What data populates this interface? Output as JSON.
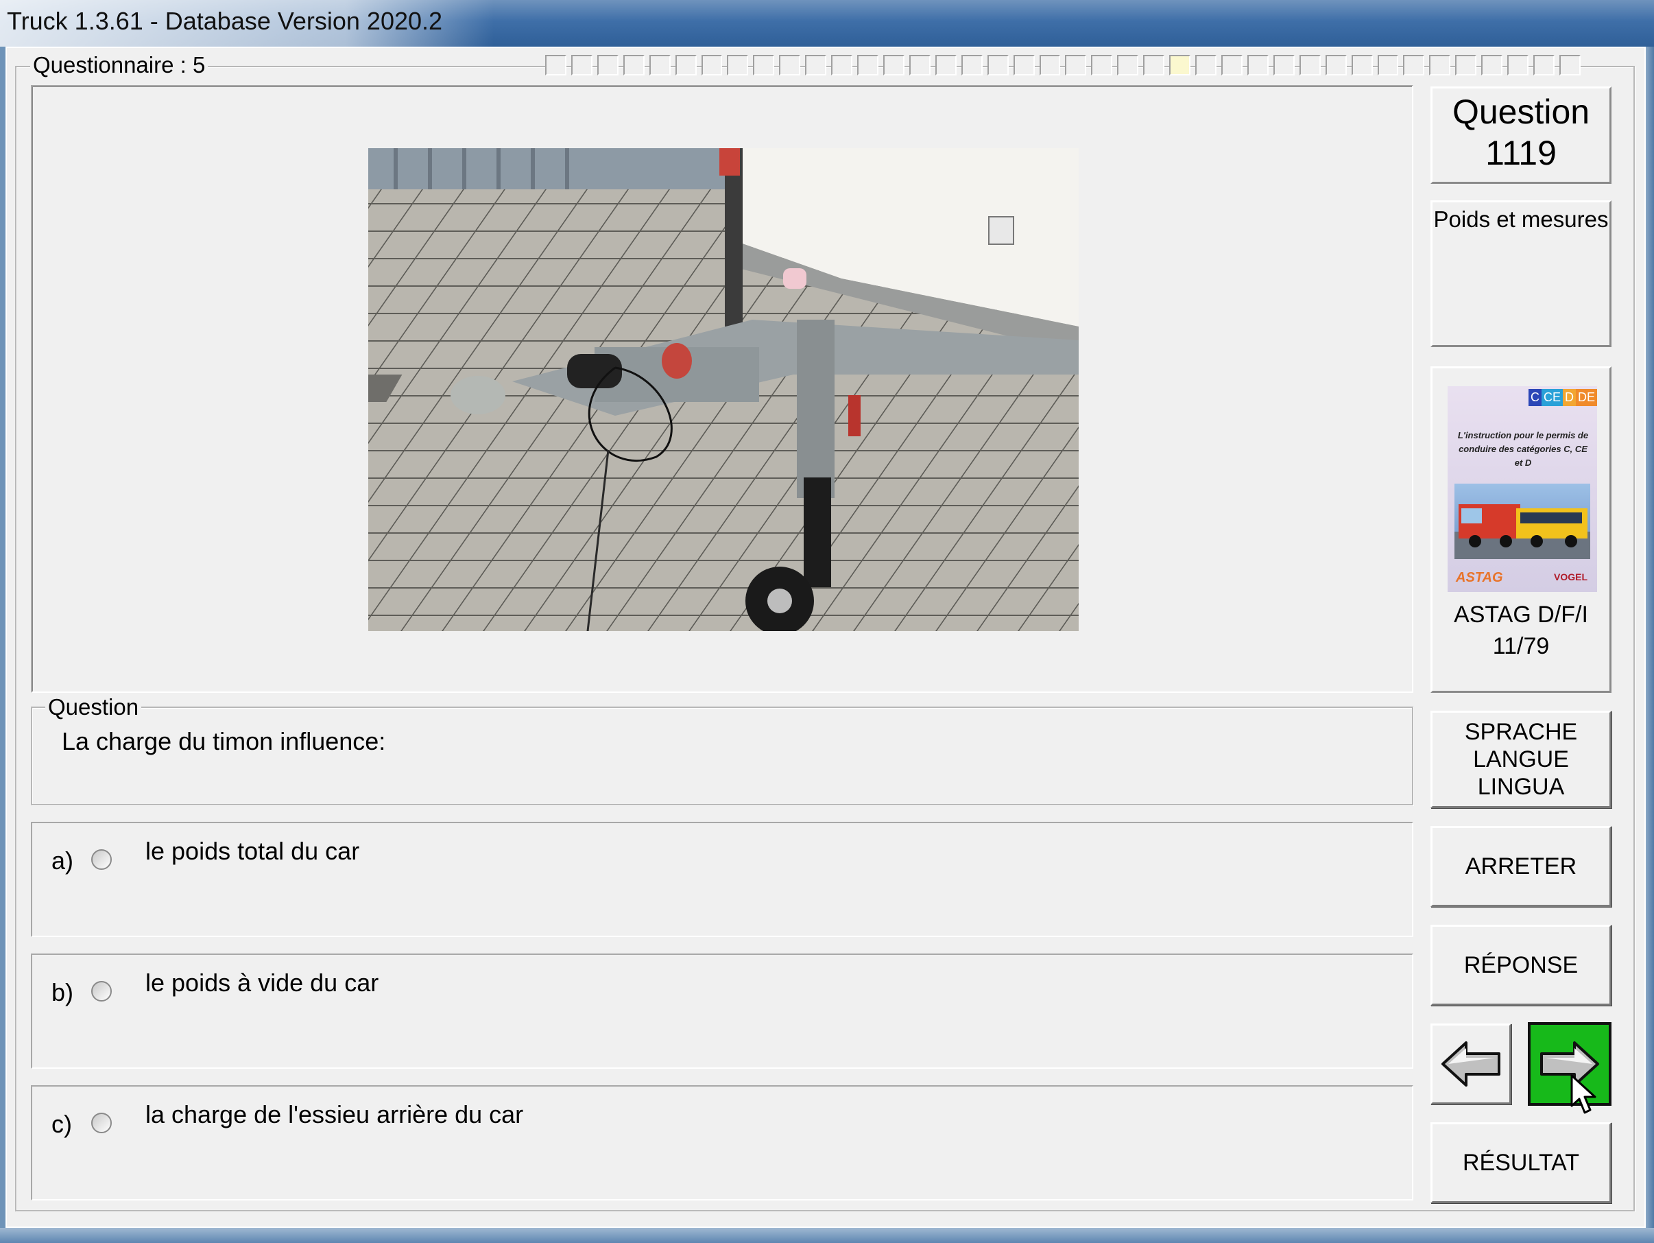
{
  "window": {
    "title": "Truck 1.3.61 - Database Version 2020.2"
  },
  "questionnaire": {
    "label": "Questionnaire : 5",
    "progress_segments": 40,
    "current_segment": 25
  },
  "sidebar": {
    "question_label": "Question",
    "question_number": "1119",
    "category": "Poids et mesures",
    "book": {
      "cover_tags": [
        "C",
        "CE",
        "D",
        "DE"
      ],
      "cover_text": "L'instruction pour le permis de conduire des catégories C, CE et D",
      "cover_logo_left": "ASTAG",
      "cover_logo_right": "VOGEL",
      "caption_line1": "ASTAG D/F/I",
      "caption_line2": "11/79"
    },
    "language_button": [
      "SPRACHE",
      "LANGUE",
      "LINGUA"
    ],
    "stop_button": "ARRETER",
    "answer_button": "RÉPONSE",
    "result_button": "RÉSULTAT"
  },
  "question": {
    "legend": "Question",
    "text": "La charge du timon influence:"
  },
  "answers": [
    {
      "letter": "a)",
      "text": "le poids total du car"
    },
    {
      "letter": "b)",
      "text": "le poids à vide du car"
    },
    {
      "letter": "c)",
      "text": "la charge de l'essieu arrière du car"
    }
  ],
  "colors": {
    "next_button": "#17b91a",
    "window_title_bar": "#3f6fa8",
    "client_background": "#f0f0f0"
  }
}
